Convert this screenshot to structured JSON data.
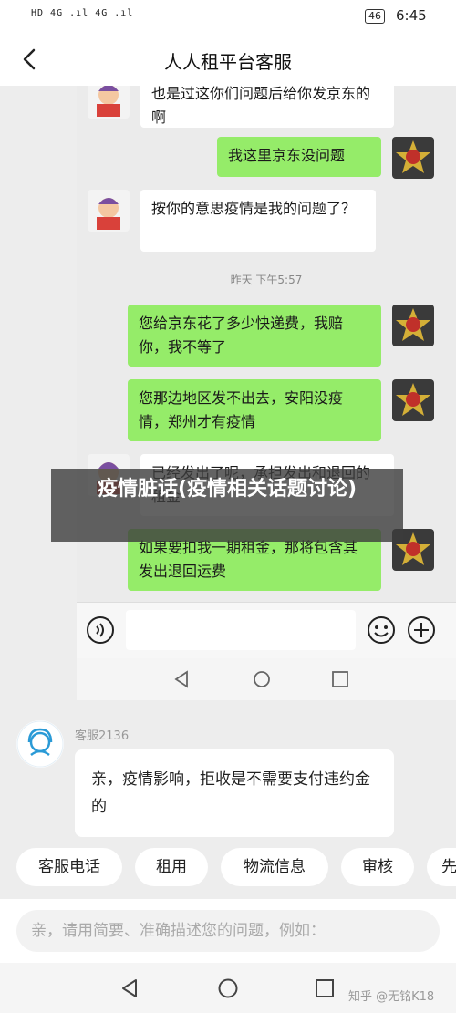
{
  "status_bar": {
    "signal": "HD 4G .ıl 4G .ıl",
    "battery": "46",
    "time": "6:45"
  },
  "header": {
    "title": "人人租平台客服"
  },
  "inner_chat": {
    "messages": [
      {
        "side": "left",
        "text": "也是过这你们问题后给你发京东的啊"
      },
      {
        "side": "right",
        "text": "我这里京东没问题"
      },
      {
        "side": "left",
        "text": "按你的意思疫情是我的问题了？"
      },
      {
        "side": "time",
        "text": "昨天 下午5:57"
      },
      {
        "side": "right",
        "text": "您给京东花了多少快递费，我赔你，我不等了"
      },
      {
        "side": "right",
        "text": "您那边地区发不出去，安阳没疫情，郑州才有疫情"
      },
      {
        "side": "left",
        "text": "已经发出了呢，承担发出和退回的租金"
      },
      {
        "side": "right",
        "text": "如果要扣我一期租金，那将包含其发出退回运费"
      }
    ]
  },
  "overlay_title": "疫情脏话(疫情相关话题讨论)",
  "cs": {
    "name": "客服2136",
    "message": "亲，疫情影响，拒收是不需要支付违约金的"
  },
  "chips": [
    "客服电话",
    "租用",
    "物流信息",
    "审核",
    "先"
  ],
  "input": {
    "placeholder": "亲，请用简要、准确描述您的问题，例如："
  },
  "watermark": "知乎 @无铭K18"
}
